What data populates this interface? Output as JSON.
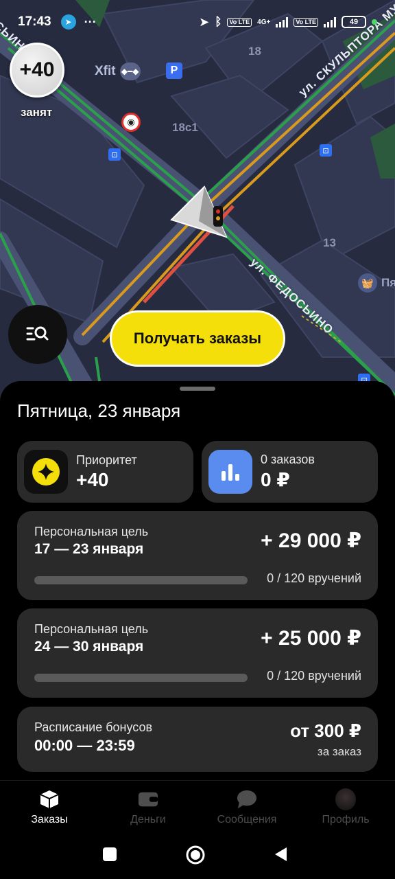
{
  "status_bar": {
    "time": "17:43",
    "dots": "···",
    "network_label": "4G+",
    "volte_label": "Vo LTE",
    "battery": "49"
  },
  "map": {
    "priority_badge": "+40",
    "status_label": "занят",
    "building_labels": [
      "18",
      "18с1",
      "13"
    ],
    "poi_xfit": "Xfit",
    "parking_label": "P",
    "shop_label": "Пя",
    "street_1": "ул. СКУЛЬПТОРА МУХИ",
    "street_2": "ул. ФЕДОСЬИНО",
    "street_3": "ОСЬИНО"
  },
  "get_orders_label": "Получать заказы",
  "sheet": {
    "date_title": "Пятница, 23 января",
    "priority_card": {
      "label": "Приоритет",
      "value": "+40"
    },
    "orders_card": {
      "label": "0 заказов",
      "value": "0 ₽"
    },
    "goals": [
      {
        "title": "Персональная цель",
        "dates": "17 — 23 января",
        "amount": "+ 29 000 ₽",
        "progress": "0 / 120 вручений",
        "fraction": 0
      },
      {
        "title": "Персональная цель",
        "dates": "24 — 30 января",
        "amount": "+ 25 000 ₽",
        "progress": "0 / 120 вручений",
        "fraction": 0
      }
    ],
    "bonus": {
      "title": "Расписание бонусов",
      "time": "00:00 — 23:59",
      "amount": "от 300 ₽",
      "note": "за заказ"
    }
  },
  "bottom_nav": [
    {
      "label": "Заказы",
      "icon": "box-icon",
      "active": true
    },
    {
      "label": "Деньги",
      "icon": "wallet-icon",
      "active": false
    },
    {
      "label": "Сообщения",
      "icon": "chat-icon",
      "active": false
    },
    {
      "label": "Профиль",
      "icon": "avatar",
      "active": false
    }
  ],
  "colors": {
    "accent": "#f5df0a",
    "card_bg": "#2a2a2a",
    "route_green": "#2aa04a",
    "route_orange": "#d99a1e",
    "route_red": "#e05040"
  }
}
